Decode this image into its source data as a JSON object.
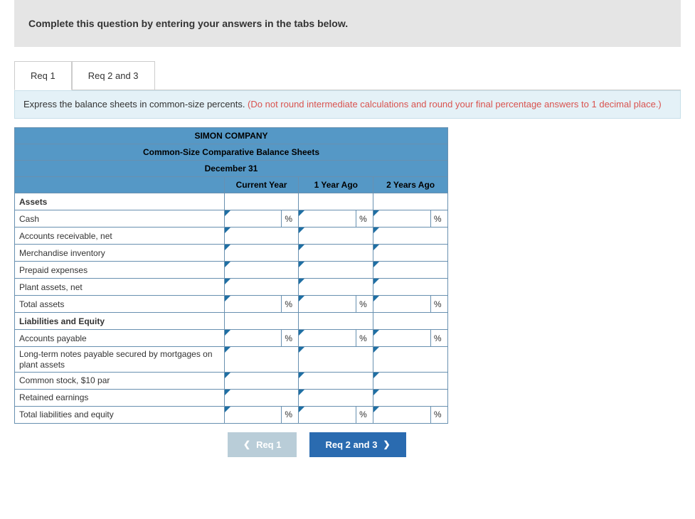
{
  "header": {
    "title": "Complete this question by entering your answers in the tabs below."
  },
  "tabs": [
    {
      "label": "Req 1",
      "active": true
    },
    {
      "label": "Req 2 and 3",
      "active": false
    }
  ],
  "instruction": {
    "text_black": "Express the balance sheets in common-size percents. ",
    "text_red": "(Do not round intermediate calculations and round your final percentage answers to 1 decimal place.)"
  },
  "table": {
    "company": "SIMON COMPANY",
    "subtitle": "Common-Size Comparative Balance Sheets",
    "date": "December 31",
    "columns": [
      "Current Year",
      "1 Year Ago",
      "2 Years Ago"
    ],
    "rows": [
      {
        "type": "section",
        "label": "Assets"
      },
      {
        "type": "item",
        "label": "Cash",
        "pct": true
      },
      {
        "type": "item",
        "label": "Accounts receivable, net",
        "pct": false
      },
      {
        "type": "item",
        "label": "Merchandise inventory",
        "pct": false
      },
      {
        "type": "item",
        "label": "Prepaid expenses",
        "pct": false
      },
      {
        "type": "item",
        "label": "Plant assets, net",
        "pct": false
      },
      {
        "type": "item",
        "label": "Total assets",
        "pct": true
      },
      {
        "type": "section",
        "label": "Liabilities and Equity"
      },
      {
        "type": "item",
        "label": "Accounts payable",
        "pct": true
      },
      {
        "type": "item_multi",
        "label": "Long-term notes payable secured by mortgages on plant assets",
        "pct": false
      },
      {
        "type": "item",
        "label": "Common stock, $10 par",
        "pct": false
      },
      {
        "type": "item",
        "label": "Retained earnings",
        "pct": false
      },
      {
        "type": "item",
        "label": "Total liabilities and equity",
        "pct": true
      }
    ],
    "pct_symbol": "%"
  },
  "nav": {
    "prev": "Req 1",
    "next": "Req 2 and 3"
  }
}
